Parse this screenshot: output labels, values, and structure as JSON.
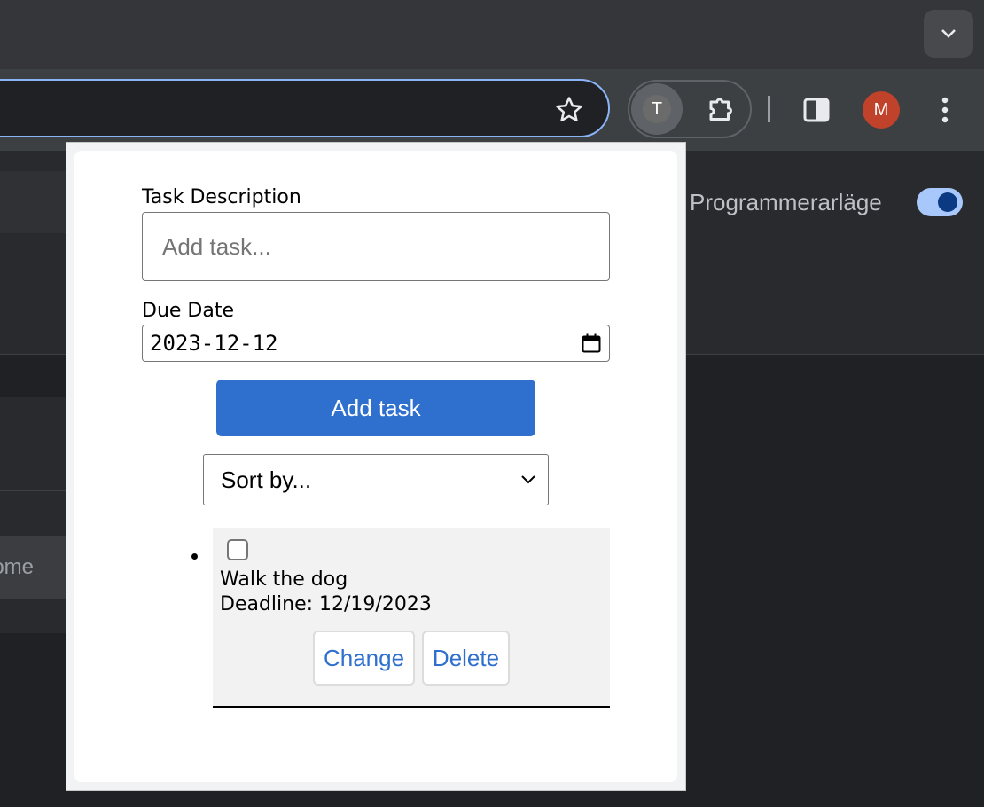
{
  "browser": {
    "extension_badge": "T",
    "profile_initial": "M",
    "accent_color": "#8ab4f8"
  },
  "background_page": {
    "dev_mode_label": "Programmerarläge",
    "dev_mode_on": true,
    "partial_input_text": "ome"
  },
  "popup": {
    "task_description_label": "Task Description",
    "task_input_placeholder": "Add task...",
    "task_input_value": "",
    "due_date_label": "Due Date",
    "due_date_value": "2023-12-12",
    "add_button_label": "Add task",
    "sort_select_value": "Sort by...",
    "tasks": [
      {
        "title": "Walk the dog",
        "deadline": "Deadline: 12/19/2023",
        "completed": false,
        "change_label": "Change",
        "delete_label": "Delete"
      }
    ],
    "button_color": "#2f6fce"
  }
}
